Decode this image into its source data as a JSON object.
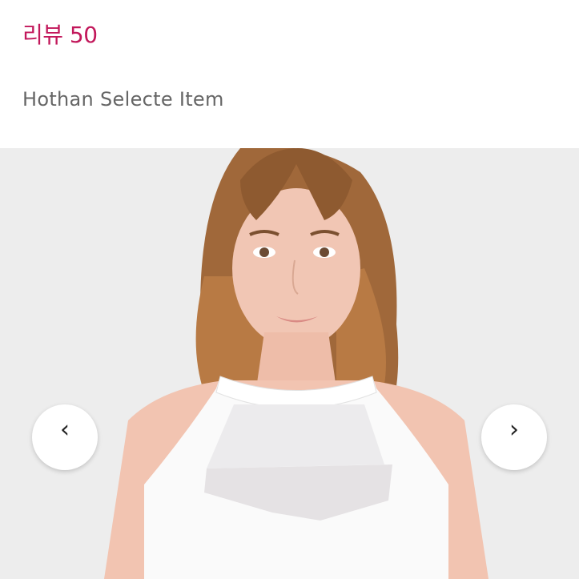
{
  "header": {
    "review_label": "리뷰 50",
    "subtitle": "Hothan Selecte Item"
  },
  "gallery": {
    "image_alt": "model wearing white halter mesh sports top",
    "prev_icon": "‹",
    "next_icon": "›"
  },
  "colors": {
    "accent": "#c2185b",
    "subtitle": "#666666",
    "background": "#ededed"
  }
}
